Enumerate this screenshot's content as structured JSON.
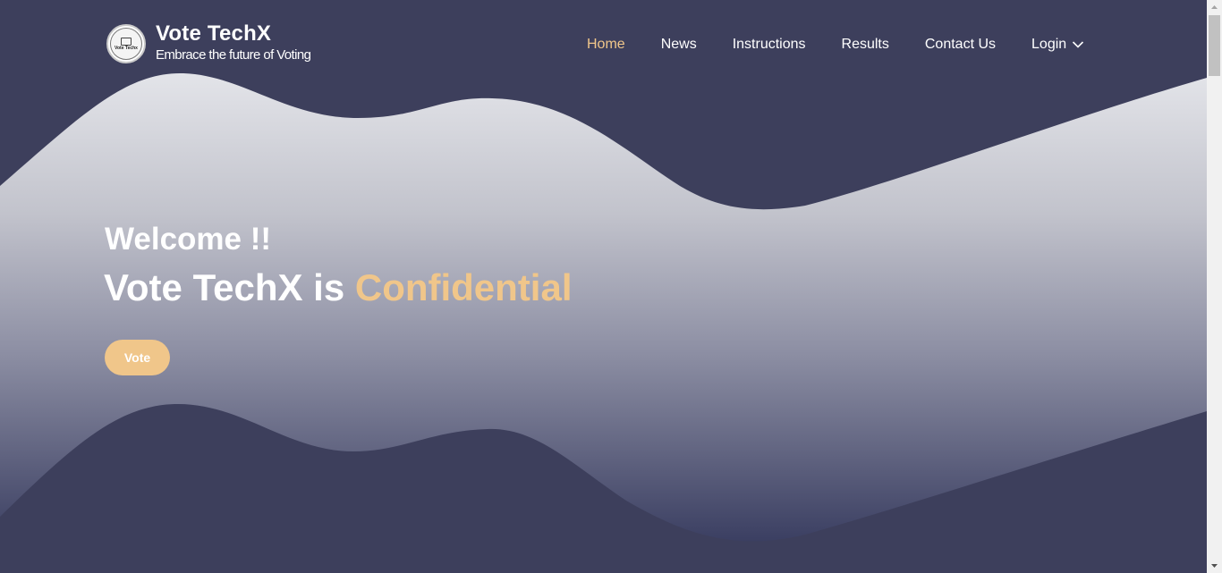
{
  "brand": {
    "logo_text": "Vote Techx",
    "title": "Vote TechX",
    "subtitle": "Embrace the future of Voting"
  },
  "nav": {
    "items": [
      {
        "label": "Home",
        "active": true
      },
      {
        "label": "News",
        "active": false
      },
      {
        "label": "Instructions",
        "active": false
      },
      {
        "label": "Results",
        "active": false
      },
      {
        "label": "Contact Us",
        "active": false
      },
      {
        "label": "Login",
        "active": false,
        "dropdown": true
      }
    ]
  },
  "hero": {
    "welcome": "Welcome !!",
    "title_prefix": "Vote TechX is ",
    "title_accent": "Confidential",
    "button_label": "Vote"
  },
  "colors": {
    "header_bg": "#3d3f5c",
    "accent": "#f0c68a",
    "gradient_top": "#e2e3e8",
    "gradient_bottom": "#3d4164"
  },
  "icons": {
    "login_dropdown": "chevron-down-icon"
  }
}
